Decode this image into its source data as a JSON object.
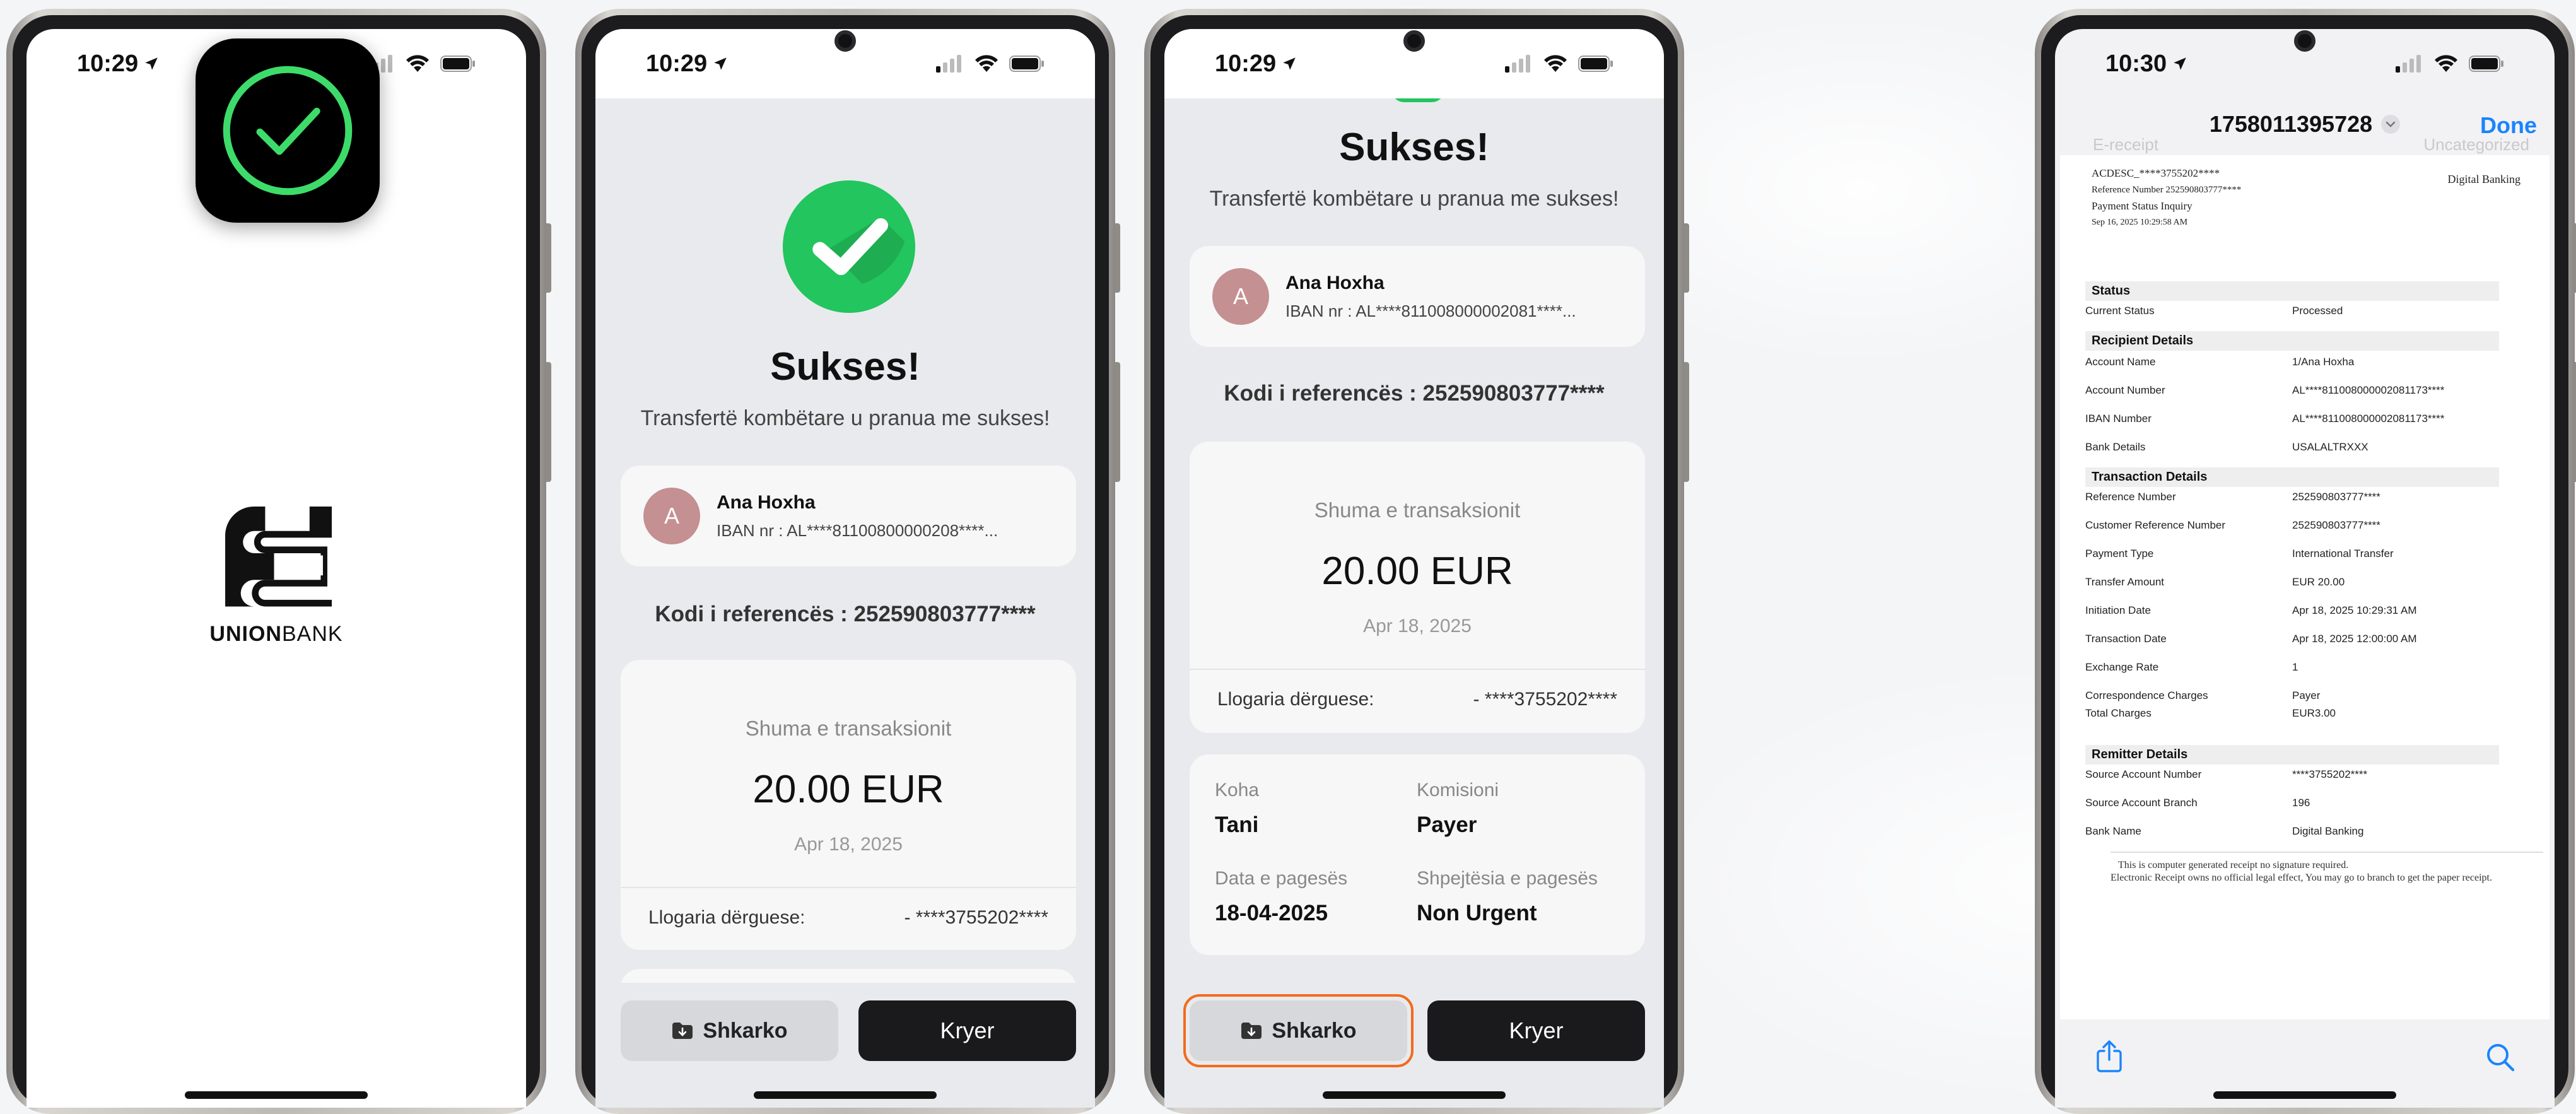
{
  "bank_name_bold": "UNION",
  "bank_name_regular": "BANK",
  "splash": {
    "time": "10:29"
  },
  "success": {
    "title": "Sukses!",
    "subtitle": "Transfertë kombëtare u pranua me sukses!",
    "recipient_initial": "A",
    "recipient_name": "Ana Hoxha",
    "recipient_iban_s2": "IBAN nr :  AL****81100800000208****...",
    "recipient_iban_s3": "IBAN nr :  AL****811008000002081****...",
    "reference_s2": "Kodi i referencës : 252590803777****",
    "reference_s3": "Kodi i referencës : 252590803777****",
    "amount_label": "Shuma e transaksionit",
    "amount": "20.00 EUR",
    "date": "Apr 18, 2025",
    "sender_label": "Llogaria dërguese:",
    "sender_value_s2": "- ****3755202****",
    "sender_value_s3": "- ****3755202****",
    "details": {
      "time_label": "Koha",
      "time_value": "Tani",
      "commission_label": "Komisioni",
      "commission_value": "Payer",
      "payment_date_label": "Data e pagesës",
      "payment_date_value": "18-04-2025",
      "speed_label": "Shpejtësia e pagesës",
      "speed_value": "Non Urgent"
    },
    "download_label": "Shkarko",
    "done_label": "Kryer",
    "time": "10:29"
  },
  "receipt_viewer": {
    "time": "10:30",
    "title": "1758011395728",
    "done_label": "Done",
    "ghost_left": "E-receipt",
    "ghost_right": "Uncategorized",
    "header_line1": "ACDESC_****3755202****",
    "header_line2": "Reference Number 252590803777****",
    "header_line3": "Payment Status Inquiry",
    "header_line4": "Sep 16, 2025 10:29:58 AM",
    "header_right": "Digital Banking",
    "sections": [
      {
        "title": "Status",
        "rows": [
          {
            "k": "Current Status",
            "v": "Processed"
          }
        ]
      },
      {
        "title": "Recipient Details",
        "rows": [
          {
            "k": "Account Name",
            "v": "1/Ana Hoxha"
          },
          {
            "k": "Account Number",
            "v": "AL****811008000002081173****"
          },
          {
            "k": "IBAN Number",
            "v": "AL****811008000002081173****"
          },
          {
            "k": "Bank Details",
            "v": "USALALTRXXX"
          }
        ]
      },
      {
        "title": "Transaction Details",
        "rows": [
          {
            "k": "Reference Number",
            "v": "252590803777****"
          },
          {
            "k": "Customer Reference Number",
            "v": "252590803777****"
          },
          {
            "k": "Payment Type",
            "v": "International Transfer"
          },
          {
            "k": "Transfer Amount",
            "v": "EUR 20.00"
          },
          {
            "k": "Initiation Date",
            "v": "Apr 18, 2025 10:29:31 AM"
          },
          {
            "k": "Transaction Date",
            "v": "Apr 18, 2025 12:00:00 AM"
          },
          {
            "k": "Exchange Rate",
            "v": "1"
          },
          {
            "k": "Correspondence Charges",
            "v": "Payer"
          },
          {
            "k": "Total Charges",
            "v": "EUR3.00"
          }
        ]
      },
      {
        "title": "Remitter Details",
        "rows": [
          {
            "k": "Source Account Number",
            "v": "****3755202****"
          },
          {
            "k": "Source Account Branch",
            "v": "196"
          },
          {
            "k": "Bank Name",
            "v": "Digital Banking"
          }
        ]
      }
    ],
    "footer_line1": "This is computer generated receipt no signature required.",
    "footer_line2": "Electronic Receipt owns no official legal effect, You may go to branch to get the paper receipt."
  },
  "colors": {
    "success_green": "#22c55e",
    "highlight_orange": "#f26b1d",
    "ios_blue": "#1a84ff"
  },
  "icons": [
    "check-circle-icon",
    "location-arrow-icon",
    "signal-icon",
    "wifi-icon",
    "battery-icon",
    "download-icon",
    "share-icon",
    "search-icon",
    "chevron-down-icon"
  ]
}
